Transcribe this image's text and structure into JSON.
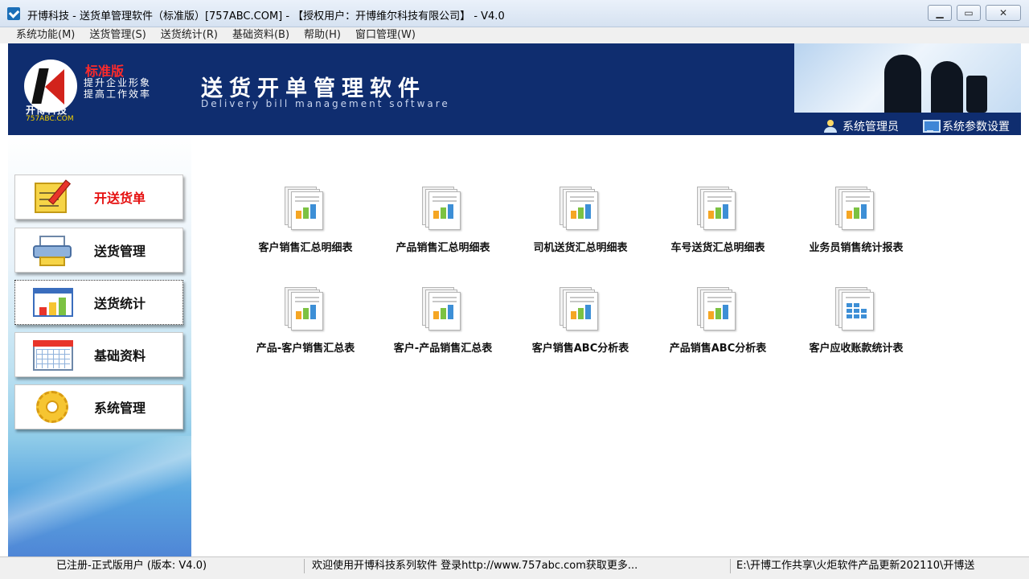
{
  "window": {
    "title": "开博科技 - 送货单管理软件（标准版）[757ABC.COM] - 【授权用户：开博维尔科技有限公司】 - V4.0",
    "minimize": "▁",
    "maximize": "▭",
    "close": "✕"
  },
  "menu": [
    "系统功能(M)",
    "送货管理(S)",
    "送货统计(R)",
    "基础资料(B)",
    "帮助(H)",
    "窗口管理(W)"
  ],
  "banner": {
    "edition": "标准版",
    "slogan1": "提升企业形象",
    "slogan2": "提高工作效率",
    "company": "开博科技",
    "url": "757ABC.COM",
    "title": "送货开单管理软件",
    "subtitle": "Delivery bill management software",
    "links": {
      "admin": "系统管理员",
      "settings": "系统参数设置"
    }
  },
  "sidebar": [
    {
      "label": "开送货单",
      "icon": "pencil-notepad-icon"
    },
    {
      "label": "送货管理",
      "icon": "printer-icon"
    },
    {
      "label": "送货统计",
      "icon": "bar-chart-window-icon"
    },
    {
      "label": "基础资料",
      "icon": "grid-table-icon"
    },
    {
      "label": "系统管理",
      "icon": "gear-icon"
    }
  ],
  "reports": [
    {
      "label": "客户销售汇总明细表",
      "icon": "report-chart-icon"
    },
    {
      "label": "产品销售汇总明细表",
      "icon": "report-chart-icon"
    },
    {
      "label": "司机送货汇总明细表",
      "icon": "report-chart-icon"
    },
    {
      "label": "车号送货汇总明细表",
      "icon": "report-chart-icon"
    },
    {
      "label": "业务员销售统计报表",
      "icon": "report-chart-icon"
    },
    {
      "label": "产品-客户销售汇总表",
      "icon": "report-chart-icon"
    },
    {
      "label": "客户-产品销售汇总表",
      "icon": "report-chart-icon"
    },
    {
      "label": "客户销售ABC分析表",
      "icon": "report-chart-icon"
    },
    {
      "label": "产品销售ABC分析表",
      "icon": "report-chart-icon"
    },
    {
      "label": "客户应收账款统计表",
      "icon": "report-table-icon"
    }
  ],
  "status": {
    "license": "已注册-正式版用户 (版本: V4.0)",
    "welcome": "欢迎使用开博科技系列软件   登录http://www.757abc.com获取更多...",
    "path": "E:\\开博工作共享\\火炬软件产品更新202110\\开博送"
  },
  "colors": {
    "banner_bg": "#0f2d6f",
    "highlight_label": "#e51010",
    "chart_orange": "#f5a623",
    "chart_green": "#7cc242",
    "chart_blue": "#3d8fd6"
  }
}
